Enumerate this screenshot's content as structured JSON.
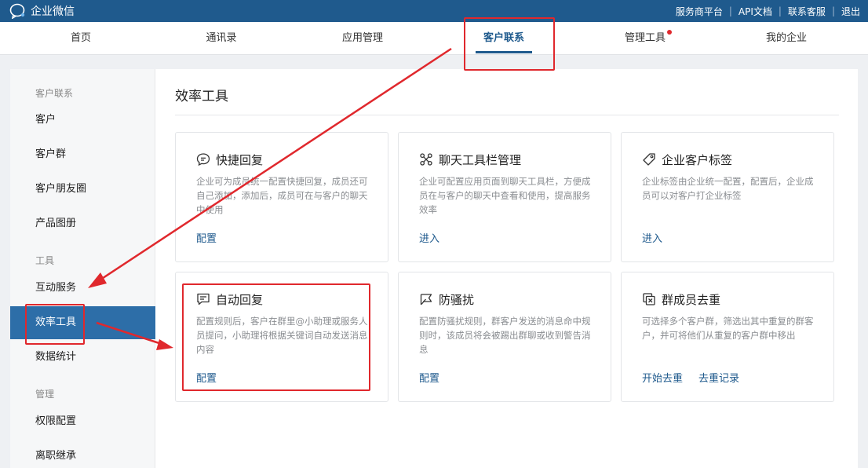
{
  "app": {
    "title": "企业微信"
  },
  "top_links": [
    "服务商平台",
    "API文档",
    "联系客服",
    "退出"
  ],
  "nav": {
    "items": [
      {
        "label": "首页"
      },
      {
        "label": "通讯录"
      },
      {
        "label": "应用管理"
      },
      {
        "label": "客户联系",
        "active": true
      },
      {
        "label": "管理工具",
        "badge": true
      },
      {
        "label": "我的企业"
      }
    ]
  },
  "sidebar": {
    "group_customer": "客户联系",
    "group_tools": "工具",
    "group_manage": "管理",
    "items": [
      {
        "label": "客户"
      },
      {
        "label": "客户群"
      },
      {
        "label": "客户朋友圈"
      },
      {
        "label": "产品图册"
      },
      {
        "label": "互动服务"
      },
      {
        "label": "效率工具",
        "active": true
      },
      {
        "label": "数据统计"
      },
      {
        "label": "权限配置"
      },
      {
        "label": "离职继承"
      }
    ]
  },
  "main": {
    "title": "效率工具",
    "cards": [
      {
        "icon": "chat-bubble-icon",
        "title": "快捷回复",
        "desc": "企业可为成员统一配置快捷回复，成员还可自己添加，添加后，成员可在与客户的聊天中使用",
        "links": [
          "配置"
        ]
      },
      {
        "icon": "toolbar-cross-icon",
        "title": "聊天工具栏管理",
        "desc": "企业可配置应用页面到聊天工具栏，方便成员在与客户的聊天中查看和使用，提高服务效率",
        "links": [
          "进入"
        ]
      },
      {
        "icon": "tag-icon",
        "title": "企业客户标签",
        "desc": "企业标签由企业统一配置，配置后，企业成员可以对客户打企业标签",
        "links": [
          "进入"
        ]
      },
      {
        "icon": "auto-reply-icon",
        "title": "自动回复",
        "desc": "配置规则后，客户在群里@小助理或服务人员提问，小助理将根据关键词自动发送消息内容",
        "links": [
          "配置"
        ]
      },
      {
        "icon": "flag-icon",
        "title": "防骚扰",
        "desc": "配置防骚扰规则，群客户发送的消息命中规则时，该成员将会被踢出群聊或收到警告消息",
        "links": [
          "配置"
        ]
      },
      {
        "icon": "dedupe-icon",
        "title": "群成员去重",
        "desc": "可选择多个客户群，筛选出其中重复的群客户，并可将他们从重复的客户群中移出",
        "links": [
          "开始去重",
          "去重记录"
        ]
      }
    ]
  },
  "colors": {
    "brand": "#1f5a8d",
    "annotation": "#e0282d",
    "active_sidebar": "#2d6ea8"
  }
}
